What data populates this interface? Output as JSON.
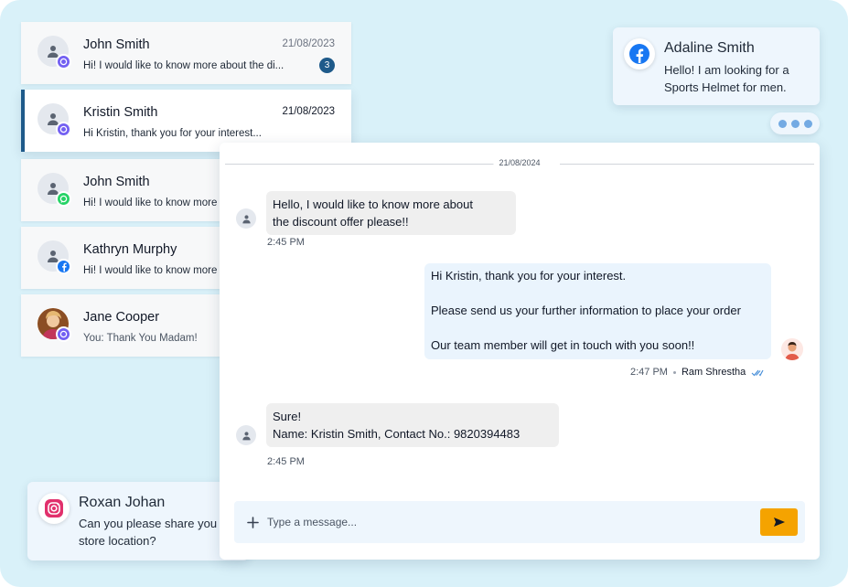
{
  "conversations": [
    {
      "name": "John Smith",
      "preview": "Hi! I would like to know more about the di...",
      "date": "21/08/2023",
      "unread": "3",
      "channel": "viber"
    },
    {
      "name": "Kristin Smith",
      "preview": "Hi Kristin, thank you for your interest...",
      "date": "21/08/2023",
      "channel": "viber"
    },
    {
      "name": "John Smith",
      "preview": "Hi! I would like to know more",
      "channel": "whatsapp"
    },
    {
      "name": "Kathryn Murphy",
      "preview": "Hi! I would like to know more",
      "channel": "facebook"
    },
    {
      "name": "Jane Cooper",
      "preview": "You: Thank You Madam!",
      "channel": "viber"
    }
  ],
  "facebook_card": {
    "name": "Adaline Smith",
    "line1": "Hello! I am looking for a",
    "line2": "Sports Helmet for men."
  },
  "instagram_card": {
    "name": "Roxan Johan",
    "line1": "Can you please share you",
    "line2": "store location?"
  },
  "chat": {
    "date_divider": "21/08/2024",
    "msg1": {
      "line1": "Hello, I would like to know more about",
      "line2": "the discount offer please!!",
      "time": "2:45 PM"
    },
    "msg2": {
      "line1": "Hi Kristin, thank you for your interest.",
      "line2": "Please send us your further information to place your order",
      "line3": "Our team member will get in touch with you soon!!",
      "time": "2:47 PM",
      "agent": "Ram Shrestha"
    },
    "msg3": {
      "line1": "Sure!",
      "line2": "Name: Kristin Smith, Contact No.: 9820394483",
      "time": "2:45 PM"
    }
  },
  "composer": {
    "placeholder": "Type a message..."
  },
  "colors": {
    "background": "#d9f1f9",
    "accent": "#1e5a8a",
    "send_button": "#f5a300",
    "viber": "#7360f2",
    "whatsapp": "#25d366",
    "facebook": "#1877f2",
    "instagram": "#e1306c"
  },
  "icons": [
    "user-icon",
    "viber-icon",
    "whatsapp-icon",
    "facebook-icon",
    "instagram-icon",
    "plus-icon",
    "send-icon",
    "double-check-icon"
  ]
}
